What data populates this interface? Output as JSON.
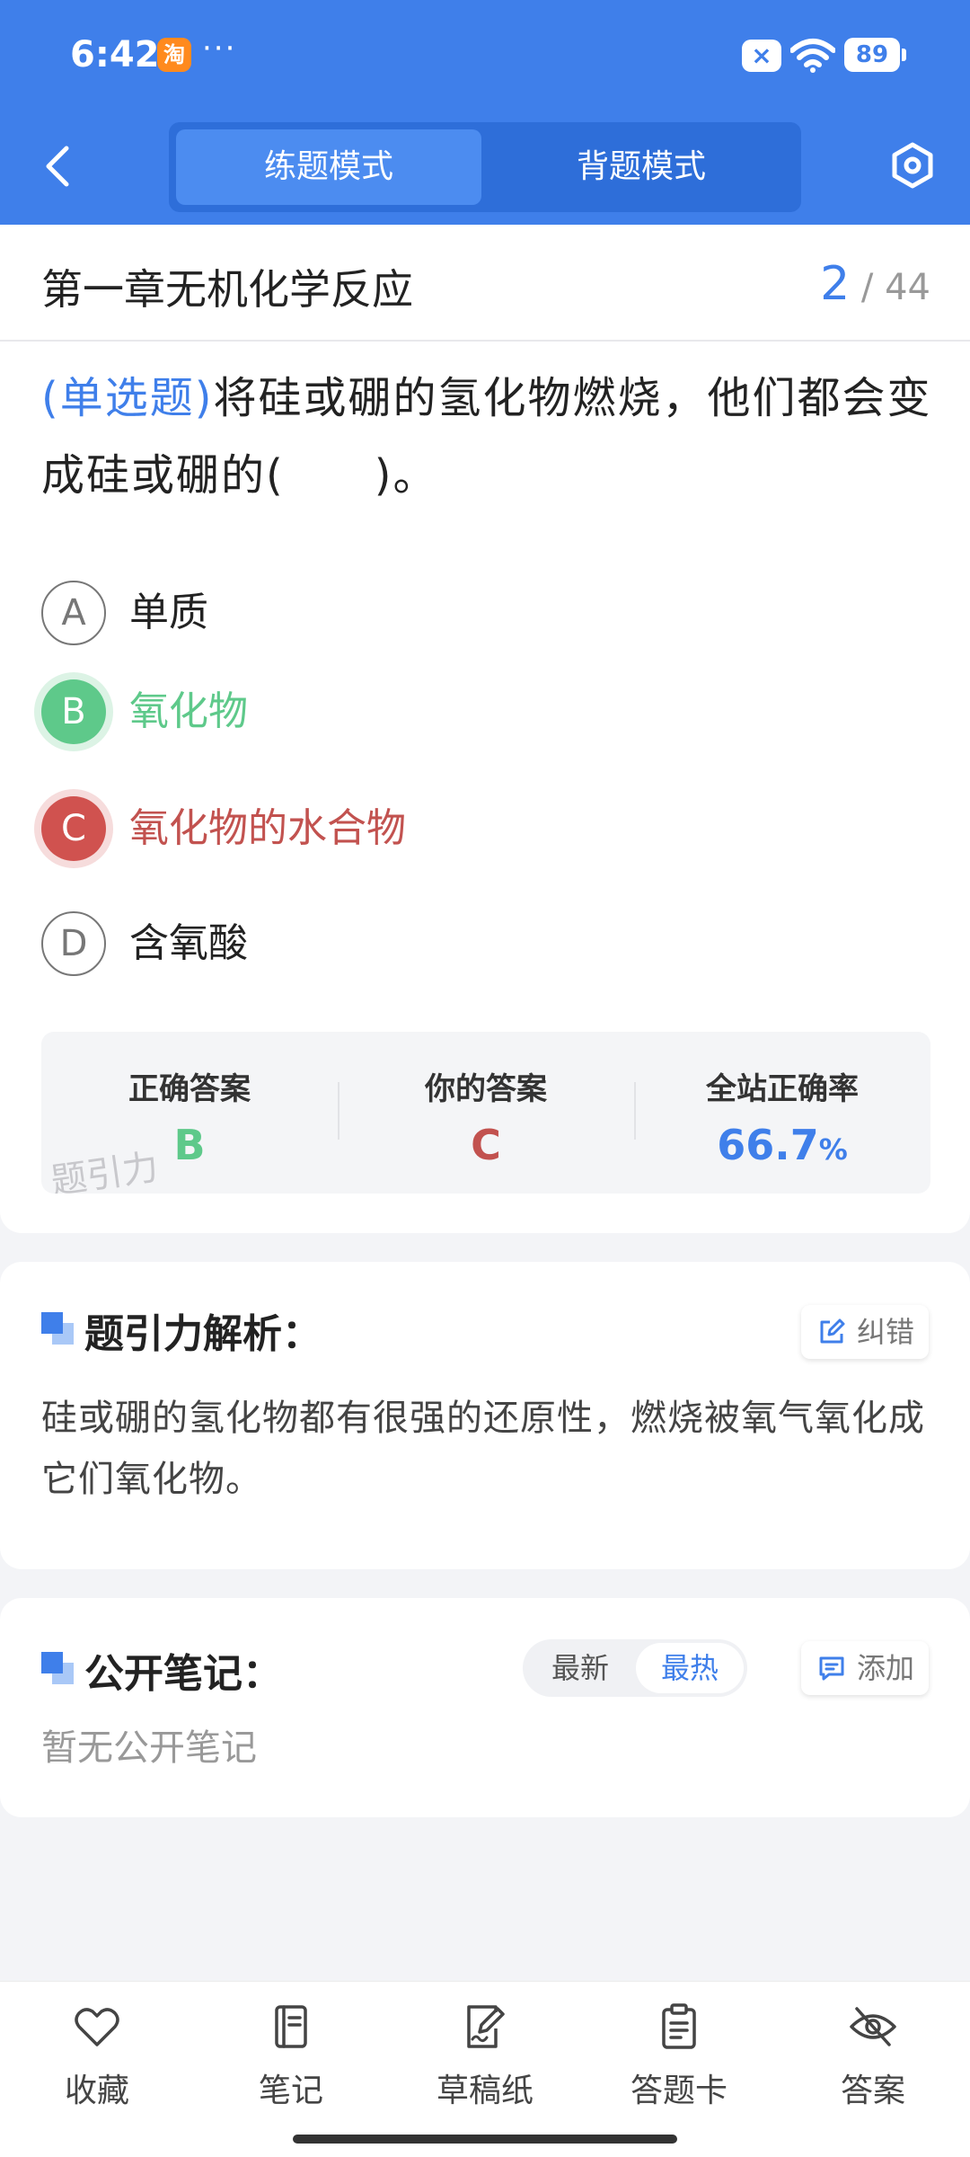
{
  "status_bar": {
    "time": "6:42",
    "taobao_char": "淘",
    "more": "···",
    "sim": "×",
    "battery": "89"
  },
  "header": {
    "tabs": [
      {
        "label": "练题模式",
        "active": true
      },
      {
        "label": "背题模式",
        "active": false
      }
    ]
  },
  "chapter": {
    "title": "第一章无机化学反应",
    "current": "2",
    "separator": " / ",
    "total": "44"
  },
  "question": {
    "type": "(单选题)",
    "text": "将硅或硼的氢化物燃烧，他们都会变成硅或硼的(　　)。"
  },
  "options": [
    {
      "letter": "A",
      "text": "单质",
      "state": "normal"
    },
    {
      "letter": "B",
      "text": "氧化物",
      "state": "correct"
    },
    {
      "letter": "C",
      "text": "氧化物的水合物",
      "state": "wrong"
    },
    {
      "letter": "D",
      "text": "含氧酸",
      "state": "normal"
    }
  ],
  "answer_summary": {
    "correct_label": "正确答案",
    "correct_value": "B",
    "yours_label": "你的答案",
    "yours_value": "C",
    "rate_label": "全站正确率",
    "rate_value": "66.7",
    "rate_unit": "%",
    "watermark": "题引力"
  },
  "analysis": {
    "title": "题引力解析：",
    "report_label": "纠错",
    "text": "硅或硼的氢化物都有很强的还原性，燃烧被氧气氧化成它们氧化物。"
  },
  "notes": {
    "title": "公开笔记：",
    "sort_newest": "最新",
    "sort_hottest": "最热",
    "add_label": "添加",
    "empty": "暂无公开笔记"
  },
  "bottom_nav": [
    {
      "label": "收藏",
      "icon": "heart-icon"
    },
    {
      "label": "笔记",
      "icon": "notebook-icon"
    },
    {
      "label": "草稿纸",
      "icon": "draft-icon"
    },
    {
      "label": "答题卡",
      "icon": "clipboard-icon"
    },
    {
      "label": "答案",
      "icon": "eye-off-icon"
    }
  ],
  "colors": {
    "primary": "#3f7fea",
    "correct": "#5ec98a",
    "wrong": "#d0524f"
  }
}
